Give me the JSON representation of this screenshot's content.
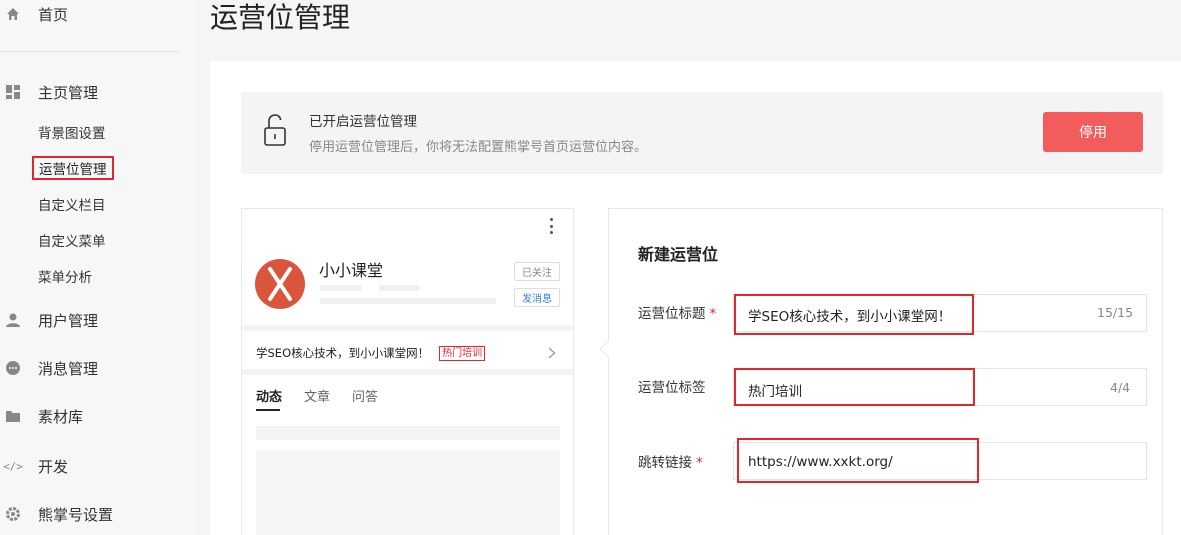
{
  "sidebar": {
    "home": "首页",
    "homepage_mgmt": "主页管理",
    "sub_items": [
      "背景图设置",
      "运营位管理",
      "自定义栏目",
      "自定义菜单",
      "菜单分析"
    ],
    "user_mgmt": "用户管理",
    "msg_mgmt": "消息管理",
    "material": "素材库",
    "dev": "开发",
    "account_settings": "熊掌号设置"
  },
  "page_title": "运营位管理",
  "notice": {
    "title": "已开启运营位管理",
    "desc": "停用运营位管理后，你将无法配置熊掌号首页运营位内容。",
    "button": "停用"
  },
  "preview": {
    "brand_name": "小小课堂",
    "follow_btn": "已关注",
    "msg_btn": "发消息",
    "promo_text": "学SEO核心技术，到小小课堂网！",
    "promo_tag": "热门培训",
    "tabs": [
      "动态",
      "文章",
      "问答"
    ]
  },
  "form": {
    "title": "新建运营位",
    "title_label": "运营位标题",
    "title_value": "学SEO核心技术，到小小课堂网！",
    "title_count": "15/15",
    "tag_label": "运营位标签",
    "tag_value": "热门培训",
    "tag_count": "4/4",
    "link_label": "跳转链接",
    "link_value": "https://www.xxkt.org/",
    "required_mark": "*"
  },
  "colors": {
    "accent_red": "#f25c5c",
    "highlight_red": "#e0272b",
    "link_blue": "#3a7bd5"
  }
}
